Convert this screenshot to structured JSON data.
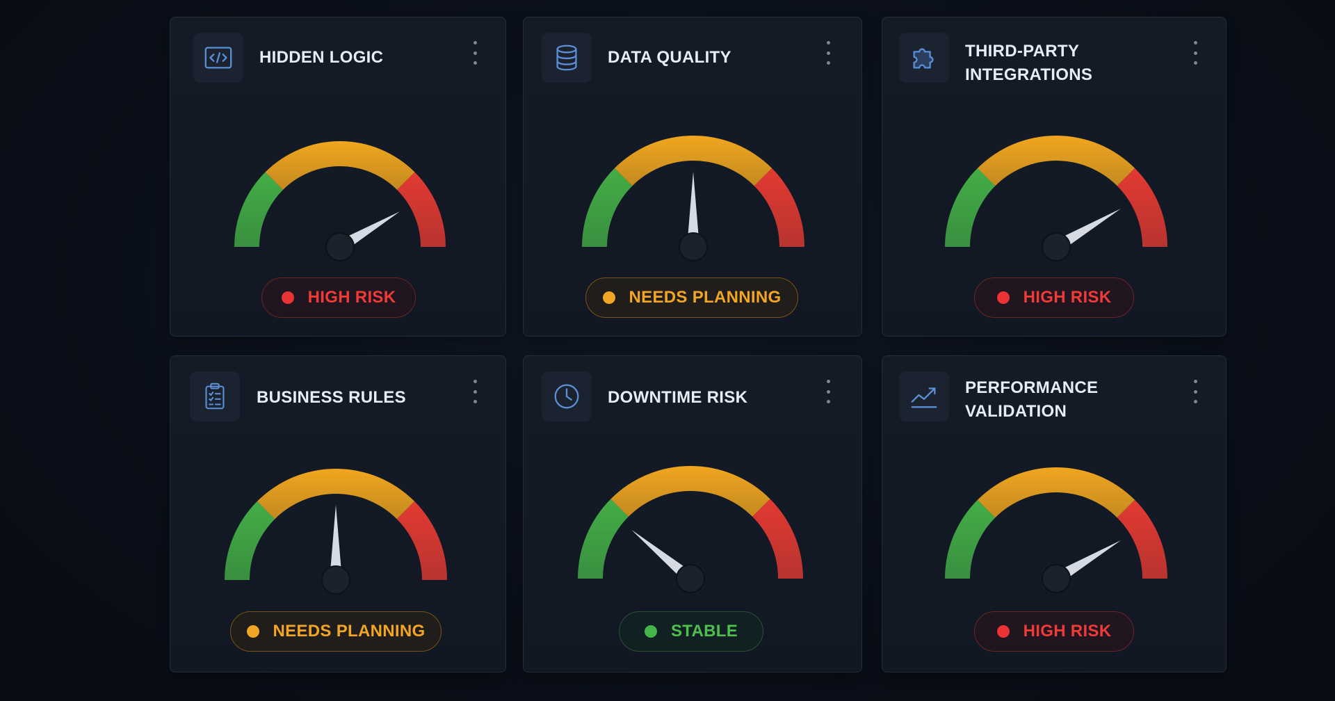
{
  "colors": {
    "green": "#43ad46",
    "amber": "#f0a61f",
    "red": "#e23a32",
    "needle": "#d6dbe3",
    "hub": "#1c222c",
    "icon": "#5b8fd6"
  },
  "cards": [
    {
      "title": "HIDDEN LOGIC",
      "icon": "code-icon",
      "status": "HIGH RISK",
      "level": "red",
      "risk_fraction": 0.83
    },
    {
      "title": "DATA QUALITY",
      "icon": "database-icon",
      "status": "NEEDS PLANNING",
      "level": "amber",
      "risk_fraction": 0.5
    },
    {
      "title_lines": [
        "THIRD-PARTY",
        "INTEGRATIONS"
      ],
      "icon": "puzzle-icon",
      "status": "HIGH RISK",
      "level": "red",
      "risk_fraction": 0.83
    },
    {
      "title": "BUSINESS RULES",
      "icon": "clipboard-checklist-icon",
      "status": "NEEDS PLANNING",
      "level": "amber",
      "risk_fraction": 0.5
    },
    {
      "title": "DOWNTIME RISK",
      "icon": "clock-icon",
      "status": "STABLE",
      "level": "green",
      "risk_fraction": 0.22
    },
    {
      "title_lines": [
        "PERFORMANCE",
        "VALIDATION"
      ],
      "icon": "trend-up-icon",
      "status": "HIGH RISK",
      "level": "red",
      "risk_fraction": 0.83
    }
  ]
}
